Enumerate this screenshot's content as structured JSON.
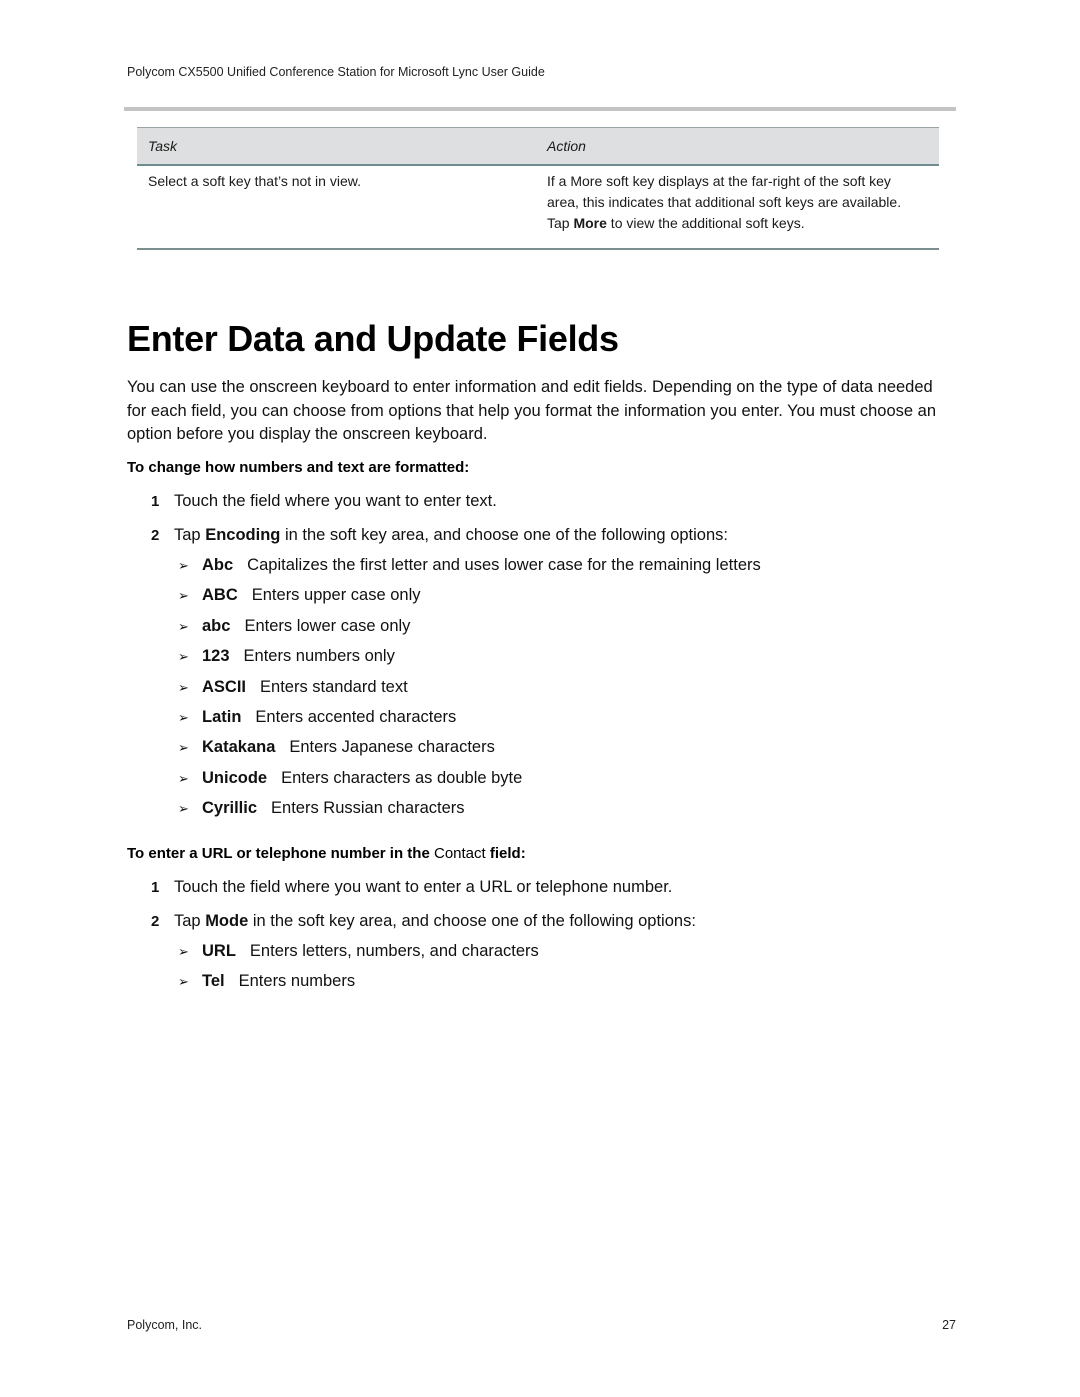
{
  "header": {
    "running_title": "Polycom CX5500 Unified Conference Station for Microsoft Lync User Guide"
  },
  "table": {
    "columns": [
      "Task",
      "Action"
    ],
    "rows": [
      {
        "task": "Select a soft key that’s not in view.",
        "action_pre": "If a More soft key displays at the far-right of the soft key area, this indicates that additional soft keys are available. Tap ",
        "action_bold": "More",
        "action_post": " to view the additional soft keys."
      }
    ]
  },
  "section": {
    "title": "Enter Data and Update Fields",
    "intro": "You can use the onscreen keyboard to enter information and edit fields. Depending on the type of data needed for each field, you can choose from options that help you format the information you enter. You must choose an option before you display the onscreen keyboard."
  },
  "procedure1": {
    "heading": "To change how numbers and text are formatted:",
    "steps": [
      {
        "num": "1",
        "pre": "Touch the field where you want to enter text.",
        "bold": "",
        "post": ""
      },
      {
        "num": "2",
        "pre": "Tap ",
        "bold": "Encoding",
        "post": " in the soft key area, and choose one of the following options:"
      }
    ],
    "bullet_icon": "arrow-bullet-icon",
    "options": [
      {
        "key": "Abc",
        "desc": "Capitalizes the first letter and uses lower case for the remaining letters"
      },
      {
        "key": "ABC",
        "desc": "Enters upper case only"
      },
      {
        "key": "abc",
        "desc": "Enters lower case only"
      },
      {
        "key": "123",
        "desc": "Enters numbers only"
      },
      {
        "key": "ASCII",
        "desc": "Enters standard text"
      },
      {
        "key": "Latin",
        "desc": "Enters accented characters"
      },
      {
        "key": "Katakana",
        "desc": "Enters Japanese characters"
      },
      {
        "key": "Unicode",
        "desc": "Enters characters as double byte"
      },
      {
        "key": "Cyrillic",
        "desc": "Enters Russian characters"
      }
    ]
  },
  "procedure2": {
    "heading_pre": "To enter a URL or telephone number in the ",
    "heading_plain": "Contact",
    "heading_post": " field:",
    "steps": [
      {
        "num": "1",
        "pre": "Touch the field where you want to enter a URL or telephone number.",
        "bold": "",
        "post": ""
      },
      {
        "num": "2",
        "pre": "Tap ",
        "bold": "Mode",
        "post": " in the soft key area, and choose one of the following options:"
      }
    ],
    "options": [
      {
        "key": "URL",
        "desc": "Enters letters, numbers, and characters"
      },
      {
        "key": "Tel",
        "desc": "Enters numbers"
      }
    ]
  },
  "footer": {
    "company": "Polycom, Inc.",
    "page_number": "27"
  }
}
